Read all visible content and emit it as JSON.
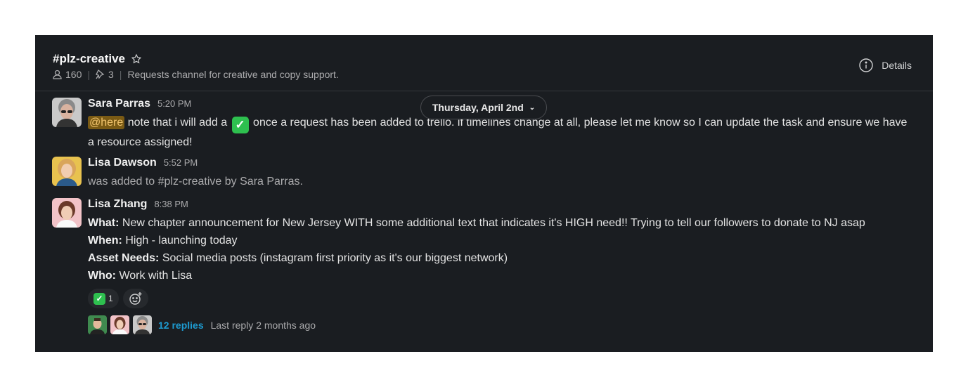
{
  "channel": {
    "name": "#plz-creative",
    "members": "160",
    "pins": "3",
    "description": "Requests channel for creative and copy support.",
    "details_label": "Details"
  },
  "date_divider": {
    "label": "Thursday, April 2nd"
  },
  "messages": [
    {
      "author": "Sara Parras",
      "time": "5:20 PM",
      "mention": "@here",
      "text_before_emoji": "note that i will add a",
      "text_after_emoji": "once a request has been added to trello. if timelines change at all, please let me know so I can update the task and ensure we have a resource assigned!"
    },
    {
      "author": "Lisa Dawson",
      "time": "5:52 PM",
      "system_text": "was added to #plz-creative by Sara Parras."
    },
    {
      "author": "Lisa Zhang",
      "time": "8:38 PM",
      "fields": [
        {
          "label": "What:",
          "value": "New chapter announcement for New Jersey WITH some additional text that indicates it's HIGH need!! Trying to tell our followers to donate to NJ asap"
        },
        {
          "label": "When:",
          "value": "High - launching today"
        },
        {
          "label": "Asset Needs:",
          "value": "Social media posts (instagram first priority as it's our biggest network)"
        },
        {
          "label": "Who:",
          "value": "Work with Lisa"
        }
      ],
      "reaction": {
        "emoji": "white-check-mark",
        "count": "1"
      },
      "thread": {
        "replies": "12 replies",
        "last_reply": "Last reply 2 months ago"
      }
    }
  ],
  "colors": {
    "background": "#1a1d21",
    "link": "#1d9bd1",
    "mention_bg": "#7a5a14",
    "check_green": "#2ec04f"
  }
}
